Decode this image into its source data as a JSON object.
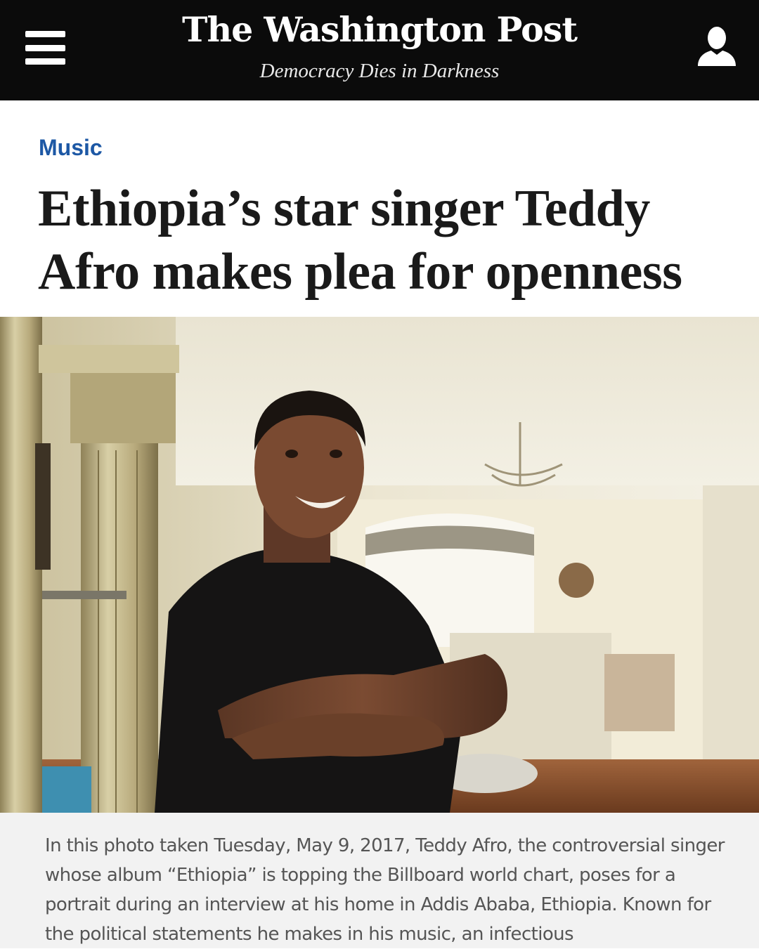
{
  "header": {
    "masthead": "The Washington Post",
    "tagline": "Democracy Dies in Darkness",
    "menu_icon": "hamburger-menu-icon",
    "user_icon": "user-account-icon",
    "background_color": "#0b0b0b"
  },
  "article": {
    "section": "Music",
    "section_color": "#1d58a5",
    "headline": "Ethiopia’s star singer Teddy Afro makes plea for openness",
    "caption": "In this photo taken Tuesday, May 9, 2017, Teddy Afro, the controversial singer whose album “Ethiopia” is topping the Billboard world chart, poses for a portrait during an interview at his home in Addis Ababa, Ethiopia. Known for the political statements he makes in his music, an infectious"
  }
}
